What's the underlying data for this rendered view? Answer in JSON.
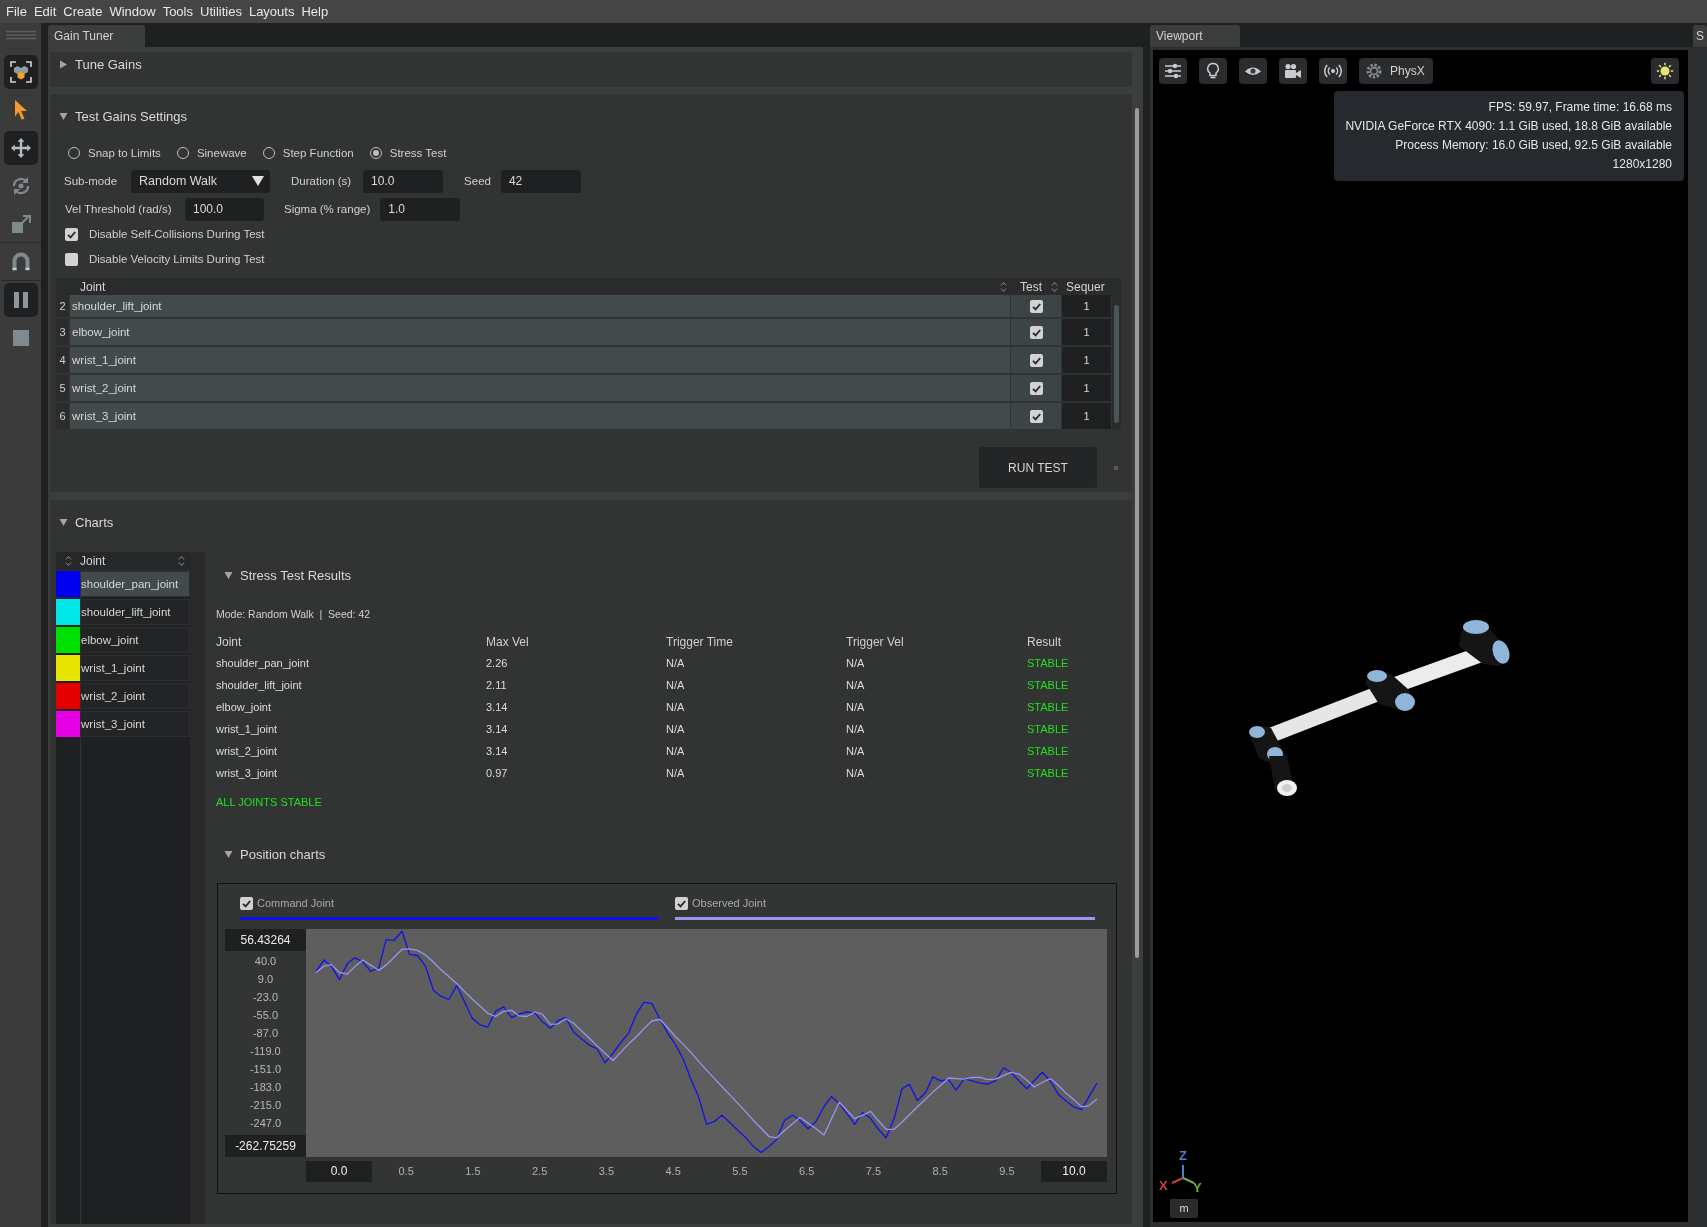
{
  "menu_bar": {
    "items": [
      "File",
      "Edit",
      "Create",
      "Window",
      "Tools",
      "Utilities",
      "Layouts",
      "Help"
    ]
  },
  "toolbar": {
    "tools": [
      {
        "kind": "select-mode",
        "active": true
      },
      {
        "kind": "pointer",
        "active": false
      },
      {
        "kind": "move",
        "active": true
      },
      {
        "kind": "rotate",
        "active": false
      },
      {
        "kind": "scale",
        "active": false
      },
      {
        "kind": "snap",
        "active": false
      },
      {
        "kind": "pause",
        "active": true
      },
      {
        "kind": "stop",
        "active": false
      }
    ]
  },
  "gain_tuner": {
    "tab": "Gain Tuner",
    "tune_gains": {
      "title": "Tune Gains",
      "expanded": false
    },
    "test_gains_settings": {
      "title": "Test Gains Settings",
      "expanded": true,
      "modes": [
        {
          "label": "Snap to Limits",
          "selected": false
        },
        {
          "label": "Sinewave",
          "selected": false
        },
        {
          "label": "Step Function",
          "selected": false
        },
        {
          "label": "Stress Test",
          "selected": true
        }
      ],
      "sub_mode": {
        "label": "Sub-mode",
        "value": "Random Walk"
      },
      "duration": {
        "label": "Duration (s)",
        "value": "10.0"
      },
      "seed": {
        "label": "Seed",
        "value": "42"
      },
      "vel_threshold": {
        "label": "Vel Threshold (rad/s)",
        "value": "100.0"
      },
      "sigma": {
        "label": "Sigma (% range)",
        "value": "1.0"
      },
      "options": [
        {
          "label": "Disable Self-Collisions During Test",
          "checked": true
        },
        {
          "label": "Disable Velocity Limits During Test",
          "checked": false
        }
      ],
      "joint_table": {
        "columns": [
          "Joint",
          "Test",
          "Sequer"
        ],
        "rows": [
          {
            "index": "2",
            "joint": "shoulder_lift_joint",
            "test": true,
            "sequence": "1"
          },
          {
            "index": "3",
            "joint": "elbow_joint",
            "test": true,
            "sequence": "1"
          },
          {
            "index": "4",
            "joint": "wrist_1_joint",
            "test": true,
            "sequence": "1"
          },
          {
            "index": "5",
            "joint": "wrist_2_joint",
            "test": true,
            "sequence": "1"
          },
          {
            "index": "6",
            "joint": "wrist_3_joint",
            "test": true,
            "sequence": "1"
          }
        ]
      },
      "run_button": "RUN TEST"
    },
    "charts": {
      "title": "Charts",
      "expanded": true,
      "joint_list": {
        "column": "Joint",
        "items": [
          {
            "name": "shoulder_pan_joint",
            "color": "#0000ee",
            "selected": true
          },
          {
            "name": "shoulder_lift_joint",
            "color": "#00e5e5",
            "selected": false
          },
          {
            "name": "elbow_joint",
            "color": "#00e000",
            "selected": false
          },
          {
            "name": "wrist_1_joint",
            "color": "#e5e500",
            "selected": false
          },
          {
            "name": "wrist_2_joint",
            "color": "#e50000",
            "selected": false
          },
          {
            "name": "wrist_3_joint",
            "color": "#e500e5",
            "selected": false
          }
        ]
      },
      "stress_test_results": {
        "title": "Stress Test Results",
        "expanded": true,
        "summary": "Mode: Random Walk  |  Seed: 42",
        "columns": [
          "Joint",
          "Max Vel",
          "Trigger Time",
          "Trigger Vel",
          "Result"
        ],
        "rows": [
          [
            "shoulder_pan_joint",
            "2.26",
            "N/A",
            "N/A",
            "STABLE"
          ],
          [
            "shoulder_lift_joint",
            "2.11",
            "N/A",
            "N/A",
            "STABLE"
          ],
          [
            "elbow_joint",
            "3.14",
            "N/A",
            "N/A",
            "STABLE"
          ],
          [
            "wrist_1_joint",
            "3.14",
            "N/A",
            "N/A",
            "STABLE"
          ],
          [
            "wrist_2_joint",
            "3.14",
            "N/A",
            "N/A",
            "STABLE"
          ],
          [
            "wrist_3_joint",
            "0.97",
            "N/A",
            "N/A",
            "STABLE"
          ]
        ],
        "verdict": "ALL JOINTS STABLE"
      },
      "position_charts": {
        "title": "Position charts",
        "expanded": true,
        "legend": [
          {
            "label": "Command Joint",
            "checked": true
          },
          {
            "label": "Observed Joint",
            "checked": true
          }
        ],
        "y_max": "56.43264",
        "y_min": "-262.75259",
        "x_min": "0.0",
        "x_max": "10.0",
        "chart_data": {
          "type": "line",
          "x": [
            -0.85,
            -0.73,
            -0.62,
            -0.5,
            -0.38,
            -0.27,
            -0.15,
            -0.03,
            0.09,
            0.2,
            0.32,
            0.44,
            0.55,
            0.67,
            0.79,
            0.91,
            1.02,
            1.14,
            1.26,
            1.37,
            1.49,
            1.61,
            1.72,
            1.84,
            1.96,
            2.08,
            2.19,
            2.31,
            2.43,
            2.54,
            2.66,
            2.78,
            2.89,
            3.01,
            3.13,
            3.25,
            3.36,
            3.48,
            3.6,
            3.71,
            3.83,
            3.95,
            4.06,
            4.18,
            4.3,
            4.42,
            4.53,
            4.65,
            4.77,
            4.88,
            5.0,
            5.12,
            5.23,
            5.35,
            5.47,
            5.59,
            5.7,
            5.82,
            5.94,
            6.05,
            6.17,
            6.29,
            6.4,
            6.52,
            6.64,
            6.76,
            6.87,
            6.99,
            7.11,
            7.22,
            7.34,
            7.46,
            7.57,
            7.69,
            7.81,
            7.93,
            8.04,
            8.16,
            8.28,
            8.39,
            8.51,
            8.63,
            8.74,
            8.86,
            8.98,
            9.1,
            9.21,
            9.33,
            9.45,
            9.56,
            9.68,
            9.8,
            9.91,
            10.03,
            10.15,
            10.27,
            10.38,
            10.5,
            10.62,
            10.73,
            10.85
          ],
          "series": [
            {
              "color": "#1212e8",
              "values": [
                22,
                42,
                31,
                7,
                36,
                46,
                39,
                22,
                28,
                78,
                77,
                93,
                52,
                50,
                31,
                -12,
                -22,
                -28,
                -3,
                -31,
                -61,
                -73,
                -77,
                -49,
                -41,
                -60,
                -54,
                -50,
                -52,
                -67,
                -79,
                -65,
                -60,
                -86,
                -98,
                -109,
                -115,
                -140,
                -123,
                -105,
                -88,
                -54,
                -33,
                -35,
                -62,
                -88,
                -107,
                -133,
                -170,
                -200,
                -249,
                -244,
                -233,
                -246,
                -260,
                -273,
                -288,
                -299,
                -288,
                -276,
                -242,
                -233,
                -242,
                -257,
                -244,
                -218,
                -200,
                -212,
                -231,
                -249,
                -228,
                -239,
                -257,
                -273,
                -239,
                -186,
                -178,
                -207,
                -193,
                -165,
                -172,
                -170,
                -189,
                -168,
                -172,
                -176,
                -178,
                -172,
                -149,
                -157,
                -172,
                -186,
                -172,
                -157,
                -172,
                -196,
                -207,
                -218,
                -223,
                -200,
                -176
              ]
            },
            {
              "color": "#9896ee",
              "values": [
                20,
                31,
                34,
                20,
                17,
                30,
                42,
                33,
                24,
                33,
                47,
                61,
                62,
                59,
                51,
                38,
                25,
                13,
                0,
                -13,
                -27,
                -40,
                -52,
                -58,
                -49,
                -47,
                -57,
                -58,
                -50,
                -54,
                -72,
                -71,
                -62,
                -70,
                -84,
                -97,
                -110,
                -123,
                -136,
                -122,
                -107,
                -94,
                -80,
                -66,
                -63,
                -78,
                -93,
                -107,
                -122,
                -137,
                -153,
                -168,
                -182,
                -197,
                -212,
                -227,
                -242,
                -256,
                -271,
                -273,
                -260,
                -248,
                -237,
                -247,
                -257,
                -268,
                -240,
                -210,
                -225,
                -239,
                -233,
                -226,
                -242,
                -258,
                -258,
                -245,
                -232,
                -218,
                -205,
                -192,
                -180,
                -167,
                -168,
                -169,
                -166,
                -166,
                -170,
                -169,
                -163,
                -157,
                -160,
                -171,
                -183,
                -175,
                -168,
                -180,
                -193,
                -205,
                -218,
                -216,
                -204
              ]
            }
          ],
          "xlim": [
            -1,
            11
          ],
          "ylim": [
            -307,
            97
          ],
          "xticks": [
            {
              "value": 0.5,
              "label": "0.5"
            },
            {
              "value": 1.5,
              "label": "1.5"
            },
            {
              "value": 2.5,
              "label": "2.5"
            },
            {
              "value": 3.5,
              "label": "3.5"
            },
            {
              "value": 4.5,
              "label": "4.5"
            },
            {
              "value": 5.5,
              "label": "5.5"
            },
            {
              "value": 6.5,
              "label": "6.5"
            },
            {
              "value": 7.5,
              "label": "7.5"
            },
            {
              "value": 8.5,
              "label": "8.5"
            },
            {
              "value": 9.5,
              "label": "9.5"
            }
          ],
          "yticks": [
            {
              "value": 40,
              "label": "40.0"
            },
            {
              "value": 9,
              "label": "9.0"
            },
            {
              "value": -23,
              "label": "-23.0"
            },
            {
              "value": -55,
              "label": "-55.0"
            },
            {
              "value": -87,
              "label": "-87.0"
            },
            {
              "value": -119,
              "label": "-119.0"
            },
            {
              "value": -151,
              "label": "-151.0"
            },
            {
              "value": -183,
              "label": "-183.0"
            },
            {
              "value": -215,
              "label": "-215.0"
            },
            {
              "value": -247,
              "label": "-247.0"
            }
          ]
        }
      }
    }
  },
  "viewport": {
    "tab": "Viewport",
    "toolbar": [
      {
        "kind": "settings"
      },
      {
        "kind": "lighting"
      },
      {
        "kind": "visibility"
      },
      {
        "kind": "camera"
      },
      {
        "kind": "broadcast"
      },
      {
        "kind": "physics",
        "label": "PhysX"
      },
      {
        "kind": "render"
      }
    ],
    "stats": [
      "FPS: 59.97, Frame time: 16.68 ms",
      "NVIDIA GeForce RTX 4090: 1.1 GiB used, 18.8 GiB available",
      "Process Memory: 16.0 GiB used, 92.5 GiB available",
      "1280x1280"
    ],
    "axis_gizmo": {
      "axes": [
        {
          "label": "Z",
          "color": "#4a7fd0"
        },
        {
          "label": "X",
          "color": "#c84040"
        },
        {
          "label": "Y",
          "color": "#6ab04c"
        }
      ],
      "unit": "m"
    }
  },
  "side_panel": {
    "tab": "S"
  }
}
